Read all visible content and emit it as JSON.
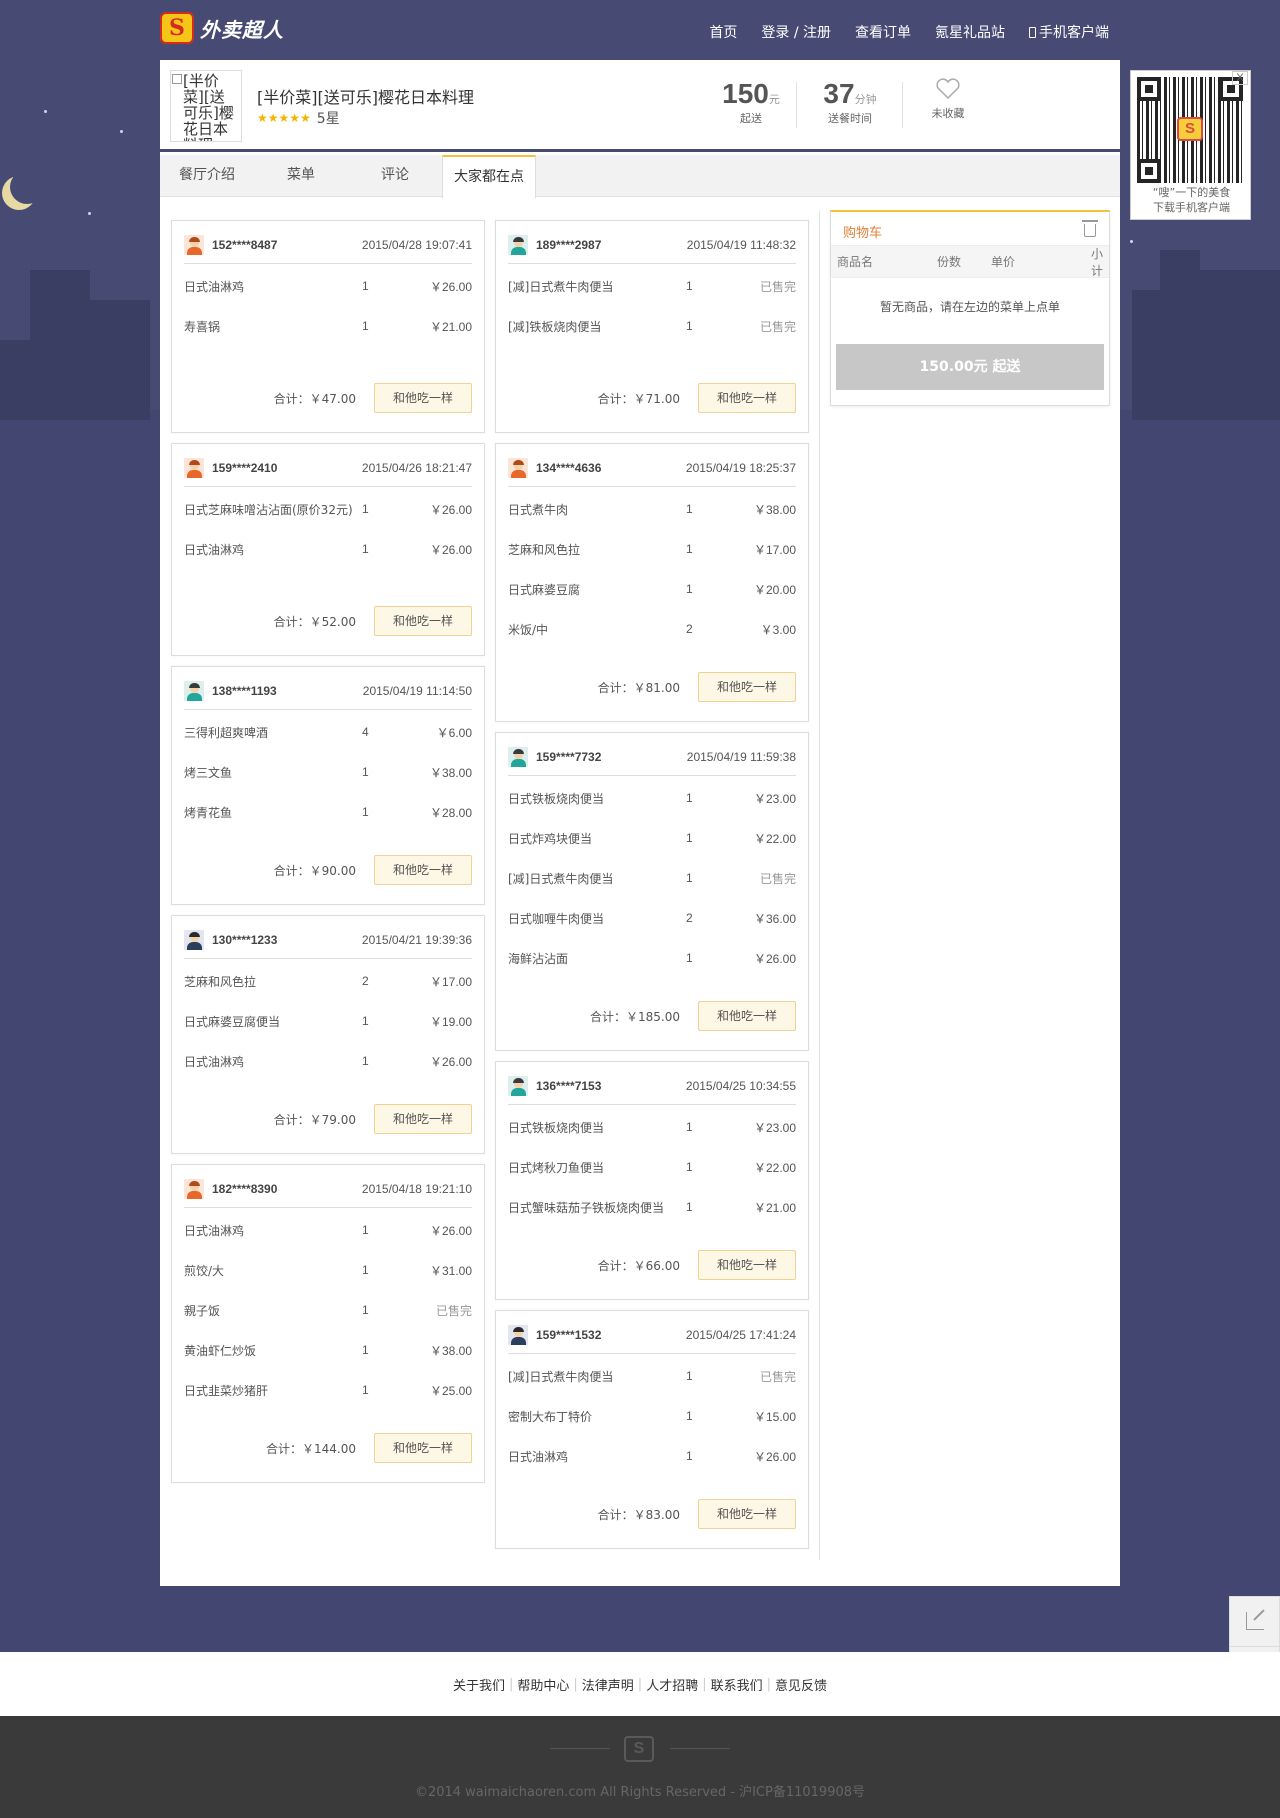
{
  "site": {
    "logo_text": "外卖超人",
    "logo_mark": "S"
  },
  "nav": [
    {
      "label": "首页"
    },
    {
      "label": "登录 / 注册"
    },
    {
      "label": "查看订单"
    },
    {
      "label": "氪星礼品站"
    },
    {
      "label": "手机客户端",
      "icon": "phone-icon"
    }
  ],
  "restaurant": {
    "image_alt": "[半价菜][送可乐]樱花日本料理",
    "name": "[半价菜][送可乐]樱花日本料理",
    "stars": "★★★★★",
    "rating_text": "5星",
    "min_order": {
      "value": "150",
      "unit": "元",
      "label": "起送"
    },
    "delivery_time": {
      "value": "37",
      "unit": "分钟",
      "label": "送餐时间"
    },
    "favorite": {
      "label": "未收藏",
      "icon": "heart-icon"
    }
  },
  "tabs": [
    {
      "label": "餐厅介绍"
    },
    {
      "label": "菜单"
    },
    {
      "label": "评论"
    },
    {
      "label": "大家都在点",
      "active": true
    }
  ],
  "orders_left": [
    {
      "avatar": "orange",
      "phone": "152****8487",
      "time": "2015/04/28 19:07:41",
      "items": [
        {
          "name": "日式油淋鸡",
          "qty": "1",
          "price": "￥26.00"
        },
        {
          "name": "寿喜锅",
          "qty": "1",
          "price": "￥21.00"
        }
      ],
      "total": "合计：￥47.00",
      "button": "和他吃一样"
    },
    {
      "avatar": "orange",
      "phone": "159****2410",
      "time": "2015/04/26 18:21:47",
      "items": [
        {
          "name": "日式芝麻味噌沾沾面(原价32元)",
          "qty": "1",
          "price": "￥26.00"
        },
        {
          "name": "日式油淋鸡",
          "qty": "1",
          "price": "￥26.00"
        }
      ],
      "total": "合计：￥52.00",
      "button": "和他吃一样"
    },
    {
      "avatar": "teal",
      "phone": "138****1193",
      "time": "2015/04/19 11:14:50",
      "items": [
        {
          "name": "三得利超爽啤酒",
          "qty": "4",
          "price": "￥6.00"
        },
        {
          "name": "烤三文鱼",
          "qty": "1",
          "price": "￥38.00"
        },
        {
          "name": "烤青花鱼",
          "qty": "1",
          "price": "￥28.00"
        }
      ],
      "total": "合计：￥90.00",
      "button": "和他吃一样"
    },
    {
      "avatar": "navy",
      "phone": "130****1233",
      "time": "2015/04/21 19:39:36",
      "items": [
        {
          "name": "芝麻和风色拉",
          "qty": "2",
          "price": "￥17.00"
        },
        {
          "name": "日式麻婆豆腐便当",
          "qty": "1",
          "price": "￥19.00"
        },
        {
          "name": "日式油淋鸡",
          "qty": "1",
          "price": "￥26.00"
        }
      ],
      "total": "合计：￥79.00",
      "button": "和他吃一样"
    },
    {
      "avatar": "orange",
      "phone": "182****8390",
      "time": "2015/04/18 19:21:10",
      "items": [
        {
          "name": "日式油淋鸡",
          "qty": "1",
          "price": "￥26.00"
        },
        {
          "name": "煎饺/大",
          "qty": "1",
          "price": "￥31.00"
        },
        {
          "name": "親子饭",
          "qty": "1",
          "price": "已售完"
        },
        {
          "name": "黄油虾仁炒饭",
          "qty": "1",
          "price": "￥38.00"
        },
        {
          "name": "日式韭菜炒猪肝",
          "qty": "1",
          "price": "￥25.00"
        }
      ],
      "total": "合计：￥144.00",
      "button": "和他吃一样"
    }
  ],
  "orders_right": [
    {
      "avatar": "teal",
      "phone": "189****2987",
      "time": "2015/04/19 11:48:32",
      "items": [
        {
          "name": "[减]日式煮牛肉便当",
          "qty": "1",
          "price": "已售完"
        },
        {
          "name": "[减]铁板烧肉便当",
          "qty": "1",
          "price": "已售完"
        }
      ],
      "total": "合计：￥71.00",
      "button": "和他吃一样"
    },
    {
      "avatar": "orange",
      "phone": "134****4636",
      "time": "2015/04/19 18:25:37",
      "items": [
        {
          "name": "日式煮牛肉",
          "qty": "1",
          "price": "￥38.00"
        },
        {
          "name": "芝麻和风色拉",
          "qty": "1",
          "price": "￥17.00"
        },
        {
          "name": "日式麻婆豆腐",
          "qty": "1",
          "price": "￥20.00"
        },
        {
          "name": "米饭/中",
          "qty": "2",
          "price": "￥3.00"
        }
      ],
      "total": "合计：￥81.00",
      "button": "和他吃一样"
    },
    {
      "avatar": "teal",
      "phone": "159****7732",
      "time": "2015/04/19 11:59:38",
      "items": [
        {
          "name": "日式铁板烧肉便当",
          "qty": "1",
          "price": "￥23.00"
        },
        {
          "name": "日式炸鸡块便当",
          "qty": "1",
          "price": "￥22.00"
        },
        {
          "name": "[减]日式煮牛肉便当",
          "qty": "1",
          "price": "已售完"
        },
        {
          "name": "日式咖喱牛肉便当",
          "qty": "2",
          "price": "￥36.00"
        },
        {
          "name": "海鲜沾沾面",
          "qty": "1",
          "price": "￥26.00"
        }
      ],
      "total": "合计：￥185.00",
      "button": "和他吃一样"
    },
    {
      "avatar": "teal",
      "phone": "136****7153",
      "time": "2015/04/25 10:34:55",
      "items": [
        {
          "name": "日式铁板烧肉便当",
          "qty": "1",
          "price": "￥23.00"
        },
        {
          "name": "日式烤秋刀鱼便当",
          "qty": "1",
          "price": "￥22.00"
        },
        {
          "name": "日式蟹味菇茄子铁板烧肉便当",
          "qty": "1",
          "price": "￥21.00"
        }
      ],
      "total": "合计：￥66.00",
      "button": "和他吃一样"
    },
    {
      "avatar": "navy",
      "phone": "159****1532",
      "time": "2015/04/25 17:41:24",
      "items": [
        {
          "name": "[减]日式煮牛肉便当",
          "qty": "1",
          "price": "已售完"
        },
        {
          "name": "密制大布丁特价",
          "qty": "1",
          "price": "￥15.00"
        },
        {
          "name": "日式油淋鸡",
          "qty": "1",
          "price": "￥26.00"
        }
      ],
      "total": "合计：￥83.00",
      "button": "和他吃一样"
    }
  ],
  "cart": {
    "title": "购物车",
    "columns": [
      "商品名",
      "份数",
      "单价",
      "小计"
    ],
    "empty_text": "暂无商品，请在左边的菜单上点单",
    "button": "150.00元 起送"
  },
  "qr": {
    "close": "X",
    "caption_line1": "“嗖”一下的美食",
    "caption_line2": "下载手机客户端"
  },
  "side_tools": {
    "feedback_icon": "edit-icon",
    "qr_icon": "qr-grid-icon"
  },
  "footer": {
    "links": [
      "关于我们",
      "帮助中心",
      "法律声明",
      "人才招聘",
      "联系我们",
      "意见反馈"
    ],
    "copyright": "©2014 waimaichaoren.com All Rights Reserved - 沪ICP备11019908号"
  },
  "colors": {
    "accent": "#f3c13a",
    "background": "#474b74",
    "cart_title": "#e0813a",
    "button_bg": "#fdf7e6"
  }
}
